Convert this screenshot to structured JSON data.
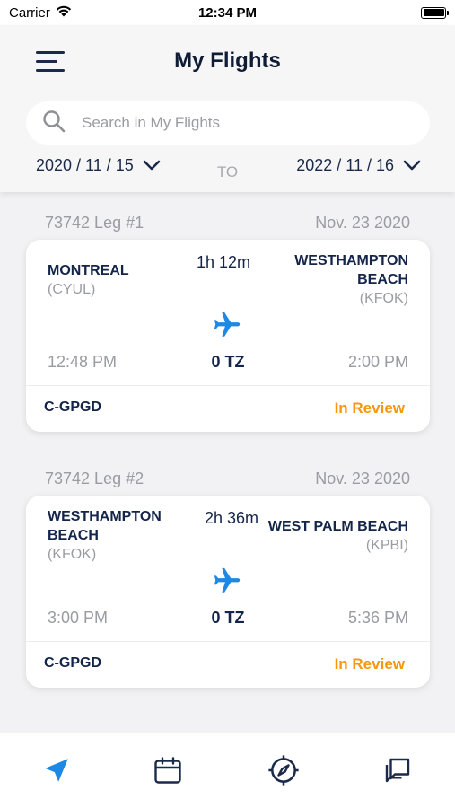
{
  "status_bar": {
    "carrier": "Carrier",
    "time": "12:34 PM"
  },
  "header": {
    "title": "My Flights"
  },
  "search": {
    "placeholder": "Search in My Flights",
    "value": ""
  },
  "date_range": {
    "from": "2020 / 11 / 15",
    "to_label": "TO",
    "to": "2022 / 11 / 16"
  },
  "legs": [
    {
      "leg_label": "73742 Leg #1",
      "date": "Nov. 23 2020",
      "from_name_lines": [
        "MONTREAL"
      ],
      "from_code": "(CYUL)",
      "to_name_lines": [
        "WESTHAMPTON",
        "BEACH"
      ],
      "to_code": "(KFOK)",
      "duration": "1h 12m",
      "dep_time": "12:48 PM",
      "tz": "0 TZ",
      "arr_time": "2:00 PM",
      "tail": "C-GPGD",
      "status": "In Review"
    },
    {
      "leg_label": "73742 Leg #2",
      "date": "Nov. 23 2020",
      "from_name_lines": [
        "WESTHAMPTON",
        "BEACH"
      ],
      "from_code": "(KFOK)",
      "to_name_lines": [
        "WEST PALM BEACH"
      ],
      "to_code": "(KPBI)",
      "duration": "2h 36m",
      "dep_time": "3:00 PM",
      "tz": "0 TZ",
      "arr_time": "5:36 PM",
      "tail": "C-GPGD",
      "status": "In Review"
    }
  ],
  "tabs": [
    {
      "icon": "navigation-arrow-icon",
      "active": true
    },
    {
      "icon": "calendar-icon",
      "active": false
    },
    {
      "icon": "compass-icon",
      "active": false
    },
    {
      "icon": "chat-icon",
      "active": false
    }
  ],
  "colors": {
    "accent": "#1e88e5",
    "navy": "#1c2a4a",
    "status_review": "#f5970f"
  }
}
